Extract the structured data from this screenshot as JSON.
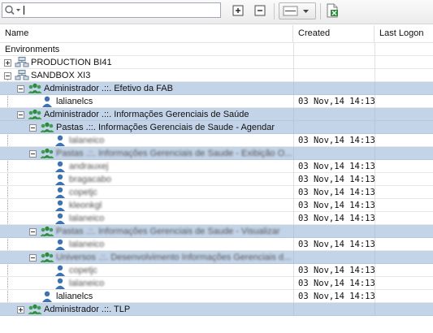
{
  "toolbar": {
    "search_value": "",
    "icons": [
      "search-dropdown-icon",
      "expand-all-icon",
      "collapse-all-icon",
      "row-lines-dropdown-icon",
      "export-excel-icon"
    ]
  },
  "columns": {
    "name": "Name",
    "created": "Created",
    "last_logon": "Last Logon"
  },
  "tree": {
    "root_label": "Environments",
    "rows": [
      {
        "level": 0,
        "type": "server",
        "toggle": "plus",
        "label": "PRODUCTION BI41",
        "created": "",
        "selected": false,
        "blurred": false
      },
      {
        "level": 0,
        "type": "server",
        "toggle": "minus",
        "label": "SANDBOX XI3",
        "created": "",
        "selected": false,
        "blurred": false
      },
      {
        "level": 1,
        "type": "group",
        "toggle": "minus",
        "label": "Administrador .::. Efetivo da FAB",
        "created": "",
        "selected": true,
        "blurred": false
      },
      {
        "level": 2,
        "type": "user",
        "toggle": "",
        "label": "lalianelcs",
        "created": "03 Nov,14 14:13",
        "selected": false,
        "blurred": false
      },
      {
        "level": 1,
        "type": "group",
        "toggle": "minus",
        "label": "Administrador .::. Informações Gerenciais de Saúde",
        "created": "",
        "selected": true,
        "blurred": false
      },
      {
        "level": 2,
        "type": "group",
        "toggle": "minus",
        "label": "Pastas .::. Informações Gerenciais de Saude - Agendar",
        "created": "",
        "selected": true,
        "blurred": false
      },
      {
        "level": 3,
        "type": "user",
        "toggle": "",
        "label": "lalaneico",
        "created": "03 Nov,14 14:13",
        "selected": false,
        "blurred": true
      },
      {
        "level": 2,
        "type": "group",
        "toggle": "minus",
        "label": "Pastas .::. Informações Gerenciais de Saude - Exibição O...",
        "created": "",
        "selected": true,
        "blurred": true
      },
      {
        "level": 3,
        "type": "user",
        "toggle": "",
        "label": "andrauxej",
        "created": "03 Nov,14 14:13",
        "selected": false,
        "blurred": true
      },
      {
        "level": 3,
        "type": "user",
        "toggle": "",
        "label": "bragacabo",
        "created": "03 Nov,14 14:13",
        "selected": false,
        "blurred": true
      },
      {
        "level": 3,
        "type": "user",
        "toggle": "",
        "label": "copetjc",
        "created": "03 Nov,14 14:13",
        "selected": false,
        "blurred": true
      },
      {
        "level": 3,
        "type": "user",
        "toggle": "",
        "label": "kleonkgl",
        "created": "03 Nov,14 14:13",
        "selected": false,
        "blurred": true
      },
      {
        "level": 3,
        "type": "user",
        "toggle": "",
        "label": "lalaneico",
        "created": "03 Nov,14 14:13",
        "selected": false,
        "blurred": true
      },
      {
        "level": 2,
        "type": "group",
        "toggle": "minus",
        "label": "Pastas .::. Informações Gerenciais de Saude - Visualizar",
        "created": "",
        "selected": true,
        "blurred": true
      },
      {
        "level": 3,
        "type": "user",
        "toggle": "",
        "label": "lalaneico",
        "created": "03 Nov,14 14:13",
        "selected": false,
        "blurred": true
      },
      {
        "level": 2,
        "type": "group",
        "toggle": "minus",
        "label": "Universos .::. Desenvolvimento Informações Gerenciais d...",
        "created": "",
        "selected": true,
        "blurred": true
      },
      {
        "level": 3,
        "type": "user",
        "toggle": "",
        "label": "copetjc",
        "created": "03 Nov,14 14:13",
        "selected": false,
        "blurred": true
      },
      {
        "level": 3,
        "type": "user",
        "toggle": "",
        "label": "lalaneico",
        "created": "03 Nov,14 14:13",
        "selected": false,
        "blurred": true
      },
      {
        "level": 2,
        "type": "user",
        "toggle": "",
        "label": "lalianelcs",
        "created": "03 Nov,14 14:13",
        "selected": false,
        "blurred": false
      },
      {
        "level": 1,
        "type": "group",
        "toggle": "plus",
        "label": "Administrador .::. TLP",
        "created": "",
        "selected": true,
        "blurred": false
      }
    ]
  },
  "colors": {
    "selected_row": "#c3d4e8",
    "user_icon": "#3f73b0",
    "group_icon": "#3aa04e"
  }
}
